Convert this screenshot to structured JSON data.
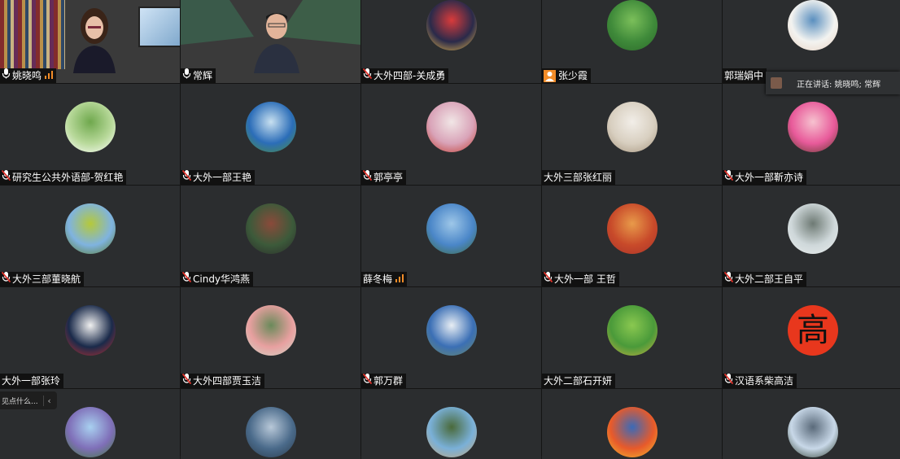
{
  "active_speaker_popup": {
    "text": "正在讲话: 姚晓鸣; 常辉"
  },
  "chat_pill": {
    "text": "见点什么...",
    "chevron": "‹"
  },
  "participants": [
    {
      "name": "姚晓鸣",
      "type": "video",
      "mic": "on",
      "audio_bars": true
    },
    {
      "name": "常辉",
      "type": "video",
      "mic": "on"
    },
    {
      "name": "大外四部-关成勇",
      "mic": "muted",
      "avatar_colors": [
        "#2a2a4a",
        "#d93b3b",
        "#e8b84a"
      ]
    },
    {
      "name": "张少霞",
      "badge": "user-icon",
      "avatar_colors": [
        "#3f8a3a",
        "#7bbf5a",
        "#2c6a2a"
      ]
    },
    {
      "name": "郭瑞娟中",
      "avatar_colors": [
        "#f3f3f0",
        "#5a8fbf",
        "#e9d2c2"
      ]
    },
    {
      "name": "研究生公共外语部-贺红艳",
      "mic": "muted",
      "avatar_colors": [
        "#b8d99a",
        "#6fa84d",
        "#ffffff"
      ]
    },
    {
      "name": "大外一部王艳",
      "mic": "muted",
      "avatar_colors": [
        "#2b6db8",
        "#c8e0f0",
        "#4e8f3d"
      ]
    },
    {
      "name": "郭亭亭",
      "mic": "muted",
      "avatar_colors": [
        "#d9a3b8",
        "#f1e6e6",
        "#c0392b"
      ]
    },
    {
      "name": "大外三部张红丽",
      "avatar_colors": [
        "#d8cfc0",
        "#f2eee8",
        "#a4937c"
      ]
    },
    {
      "name": "大外一部靳亦诗",
      "mic": "muted",
      "avatar_colors": [
        "#e85a9a",
        "#f6c2cf",
        "#5a3a2a"
      ]
    },
    {
      "name": "大外三部董晓航",
      "mic": "muted",
      "avatar_colors": [
        "#7fb3e0",
        "#b5c93a",
        "#5a7a2a"
      ]
    },
    {
      "name": "Cindy华鸿燕",
      "mic": "muted",
      "avatar_colors": [
        "#3c5a3a",
        "#8a4a3a",
        "#2a2a2a"
      ]
    },
    {
      "name": "薛冬梅",
      "audio_bars": true,
      "avatar_colors": [
        "#4a86c8",
        "#9ec7e8",
        "#3e6b3a"
      ]
    },
    {
      "name": "大外一部  王哲",
      "mic": "muted",
      "avatar_colors": [
        "#c84a2a",
        "#e89a4a",
        "#a8332a"
      ]
    },
    {
      "name": "大外二部王自平",
      "mic": "muted",
      "avatar_colors": [
        "#cfd8da",
        "#6e7a74",
        "#e8ecec"
      ]
    },
    {
      "name": "大外一部张玲",
      "avatar_colors": [
        "#1a2a4a",
        "#f0f0f0",
        "#c03030"
      ]
    },
    {
      "name": "大外四部贾玉洁",
      "mic": "muted",
      "avatar_colors": [
        "#e8a0a0",
        "#6a8a5a",
        "#cfd8c8"
      ]
    },
    {
      "name": "郭万群",
      "mic": "muted",
      "avatar_colors": [
        "#3b6fb5",
        "#e8eef4",
        "#6a8a6a"
      ]
    },
    {
      "name": "大外二部石开妍",
      "avatar_colors": [
        "#4a9a3a",
        "#8ac850",
        "#c8b040"
      ]
    },
    {
      "name": "汉语系柴高洁",
      "mic": "muted",
      "glyph": "高",
      "avatar_colors": [
        "#e8371d",
        "#e8371d",
        "#111111"
      ]
    },
    {
      "name": "",
      "avatar_colors": [
        "#7f6fb8",
        "#a8d0f0",
        "#3f7a3a"
      ]
    },
    {
      "name": "",
      "avatar_colors": [
        "#4a6a8a",
        "#b8c8d8",
        "#2a3a4a"
      ]
    },
    {
      "name": "",
      "avatar_colors": [
        "#7ab0d8",
        "#4a6a3a",
        "#c8a878"
      ]
    },
    {
      "name": "",
      "avatar_colors": [
        "#e85a2a",
        "#3a6ab8",
        "#f0c030"
      ]
    },
    {
      "name": "",
      "avatar_colors": [
        "#c8d8e8",
        "#5a6a7a",
        "#2a3a2a"
      ]
    }
  ]
}
